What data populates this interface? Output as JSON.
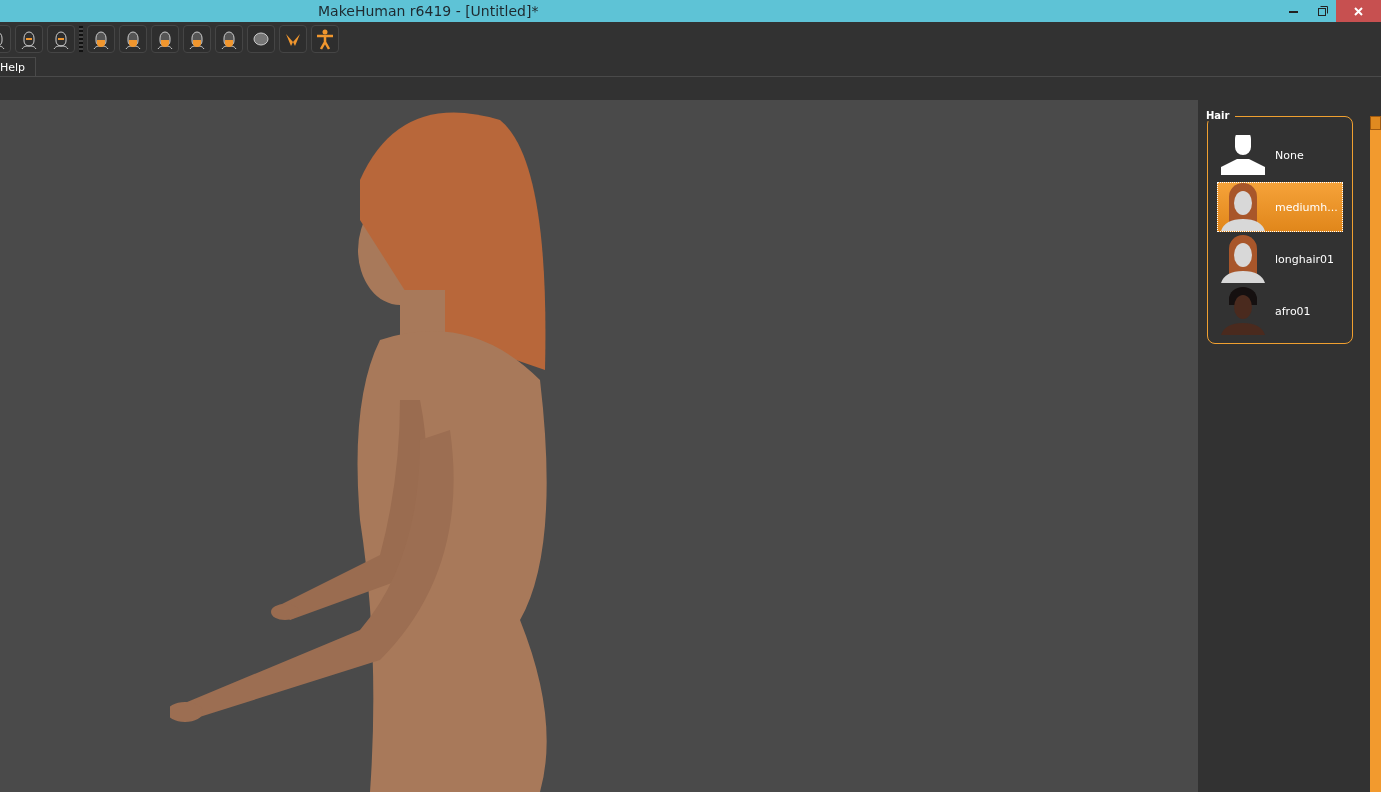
{
  "window": {
    "title": "MakeHuman r6419 - [Untitled]*"
  },
  "menu": [
    {
      "label": "Help"
    }
  ],
  "hair_panel": {
    "title": "Hair",
    "items": [
      {
        "label": "None",
        "kind": "silhouette",
        "selected": false
      },
      {
        "label": "mediumh...",
        "kind": "picture",
        "selected": true
      },
      {
        "label": "longhair01",
        "kind": "picture",
        "selected": false
      },
      {
        "label": "afro01",
        "kind": "picture",
        "selected": false
      }
    ]
  }
}
